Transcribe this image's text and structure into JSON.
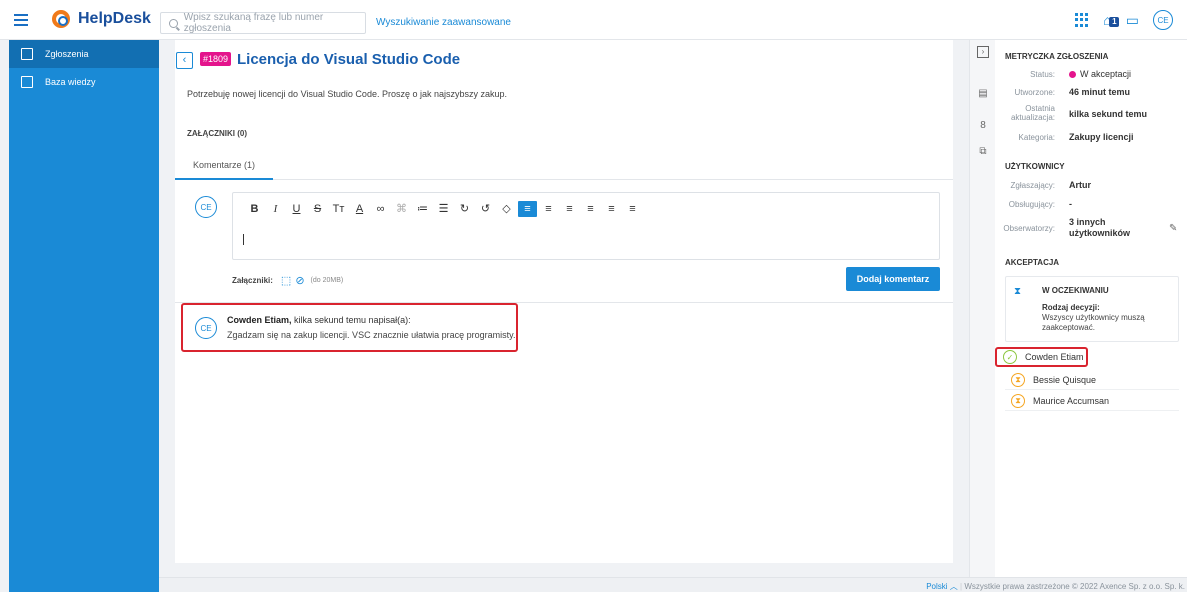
{
  "app": {
    "name": "HelpDesk"
  },
  "search": {
    "placeholder": "Wpisz szukaną frazę lub numer zgłoszenia",
    "advanced_label": "Wyszukiwanie zaawansowane"
  },
  "topbar": {
    "notification_count": "1",
    "user_initials": "CE"
  },
  "sidebar": {
    "items": [
      {
        "label": "Zgłoszenia",
        "active": true
      },
      {
        "label": "Baza wiedzy",
        "active": false
      }
    ]
  },
  "ticket": {
    "number": "#1809",
    "title": "Licencja do Visual Studio Code",
    "description": "Potrzebuję nowej licencji do Visual Studio Code. Proszę o jak najszybszy zakup.",
    "attachments_label": "ZAŁĄCZNIKI (0)"
  },
  "tabs": [
    {
      "label": "Komentarze (1)"
    }
  ],
  "composer": {
    "avatar_initials": "CE",
    "attachments_label": "Załączniki:",
    "size_limit": "(do 20MB)",
    "submit_label": "Dodaj komentarz"
  },
  "comments": [
    {
      "author": "Cowden Etiam,",
      "meta": " kilka sekund temu napisał(a):",
      "text": "Zgadzam się na zakup licencji. VSC znacznie ułatwia pracę programisty.",
      "avatar_initials": "CE"
    }
  ],
  "metrics": {
    "heading": "METRYCZKA ZGŁOSZENIA",
    "status_label": "Status:",
    "status_value": "W akceptacji",
    "status_color": "#e4148c",
    "created_label": "Utworzone:",
    "created_value": "46 minut temu",
    "updated_label_1": "Ostatnia",
    "updated_label_2": "aktualizacja:",
    "updated_value": "kilka sekund temu",
    "category_label": "Kategoria:",
    "category_value": "Zakupy licencji"
  },
  "users": {
    "heading": "UŻYTKOWNICY",
    "reporter_label": "Zgłaszający:",
    "reporter_value": "Artur",
    "handler_label": "Obsługujący:",
    "handler_value": "-",
    "observers_label": "Obserwatorzy:",
    "observers_value_1": "3 innych",
    "observers_value_2": "użytkowników"
  },
  "acceptance": {
    "heading": "AKCEPTACJA",
    "state": "W OCZEKIWANIU",
    "decision_label": "Rodzaj decyzji:",
    "decision_value": "Wszyscy użytkownicy muszą zaakceptować.",
    "approvers": [
      {
        "name": "Cowden Etiam",
        "state": "accepted"
      },
      {
        "name": "Bessie Quisque",
        "state": "waiting"
      },
      {
        "name": "Maurice Accumsan",
        "state": "waiting"
      }
    ]
  },
  "footer": {
    "language": "Polski",
    "copyright": "Wszystkie prawa zastrzeżone © 2022 Axence Sp. z o.o. Sp. k."
  },
  "colors": {
    "accent": "#1a8ad6",
    "brand_dark": "#1a4f9c",
    "badge": "#e4148c",
    "highlight": "#d9242f"
  }
}
